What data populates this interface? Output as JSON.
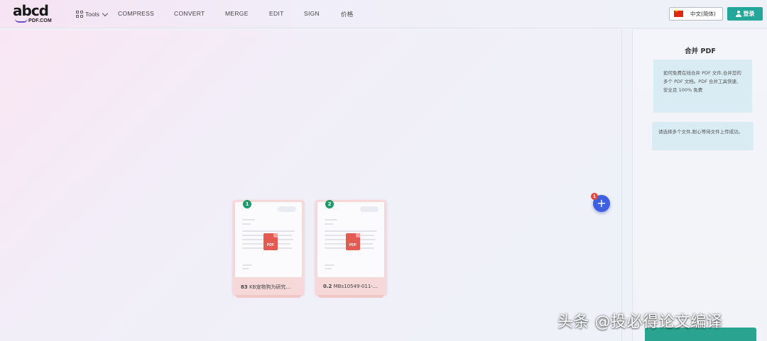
{
  "header": {
    "logo_main": "abcd",
    "logo_sub": "PDF.COM",
    "tools_label": "Tools",
    "nav": [
      "COMPRESS",
      "CONVERT",
      "MERGE",
      "EDIT",
      "SIGN",
      "价格"
    ],
    "language": "中文(简体)",
    "login_label": "登录"
  },
  "workspace": {
    "files": [
      {
        "index": "1",
        "size": "83",
        "name": "KB宠物狗为研究..."
      },
      {
        "index": "2",
        "size": "0.2",
        "name": "MBs10549-011-..."
      }
    ],
    "pdf_icon_label": "PDF",
    "add_count": "1",
    "add_symbol": "+"
  },
  "sidebar": {
    "title": "合并 PDF",
    "info_text": "如何免费在线合并 PDF 文件,合并您的多个 PDF 文档。PDF 合并工具快速、安全且 100% 免费",
    "hint_text": "请选择多个文件,耐心等待文件上传成功。"
  },
  "watermark": "头条 @投必得论文编译",
  "colors": {
    "accent_teal": "#23a79a",
    "add_button_blue": "#3d5fe0",
    "badge_green": "#1e9a6a",
    "pdf_red": "#e25a52"
  }
}
